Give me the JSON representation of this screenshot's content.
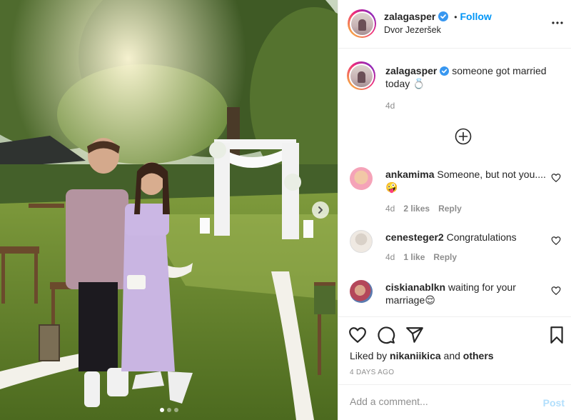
{
  "post": {
    "username": "zalagasper",
    "location": "Dvor Jezeršek",
    "follow_label": "Follow",
    "separator": "•",
    "caption": "someone got married today 💍",
    "caption_age": "4d",
    "carousel_count": 3,
    "carousel_active": 1
  },
  "comments": [
    {
      "username": "ankamima",
      "text": "Someone, but not you....🤪",
      "age": "4d",
      "likes": "2 likes",
      "reply": "Reply"
    },
    {
      "username": "cenesteger2",
      "text": "Congratulations",
      "age": "4d",
      "likes": "1 like",
      "reply": "Reply"
    },
    {
      "username": "ciskianablkn",
      "text": "waiting for your marriage😌"
    }
  ],
  "liked_by": {
    "prefix": "Liked by",
    "user": "nikaniikica",
    "and": "and",
    "others": "others"
  },
  "time_ago": "4 DAYS AGO",
  "add_comment": {
    "placeholder": "Add a comment...",
    "post_label": "Post"
  },
  "icons": {
    "verified": "verified-badge-icon",
    "more": "more-options-icon",
    "load_more": "load-more-plus-icon",
    "like": "heart-icon",
    "comment": "comment-bubble-icon",
    "share": "paper-plane-icon",
    "save": "bookmark-icon",
    "next": "chevron-right-icon"
  },
  "colors": {
    "accent": "#0095f6",
    "post_disabled": "#b2dffc",
    "muted": "#8e8e8e",
    "text": "#262626"
  }
}
